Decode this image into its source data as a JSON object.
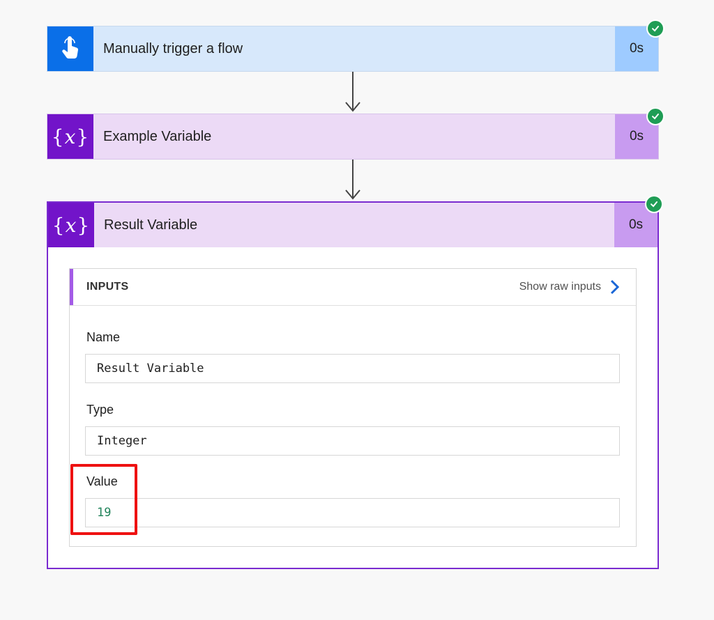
{
  "steps": [
    {
      "title": "Manually trigger a flow",
      "duration": "0s",
      "icon": "hand-touch-icon"
    },
    {
      "title": "Example Variable",
      "duration": "0s",
      "icon": "variable-icon"
    },
    {
      "title": "Result Variable",
      "duration": "0s",
      "icon": "variable-icon"
    }
  ],
  "variable_icon_glyph": {
    "open": "{",
    "var": "x",
    "close": "}"
  },
  "inputs": {
    "heading": "INPUTS",
    "show_raw_label": "Show raw inputs",
    "fields": [
      {
        "label": "Name",
        "value": "Result Variable"
      },
      {
        "label": "Type",
        "value": "Integer"
      },
      {
        "label": "Value",
        "value": "19"
      }
    ]
  },
  "colors": {
    "trigger_accent": "#0a6fe8",
    "variable_accent": "#7214c9",
    "success": "#1f9d55",
    "highlight": "#ee1111",
    "value_text": "#20835a"
  }
}
